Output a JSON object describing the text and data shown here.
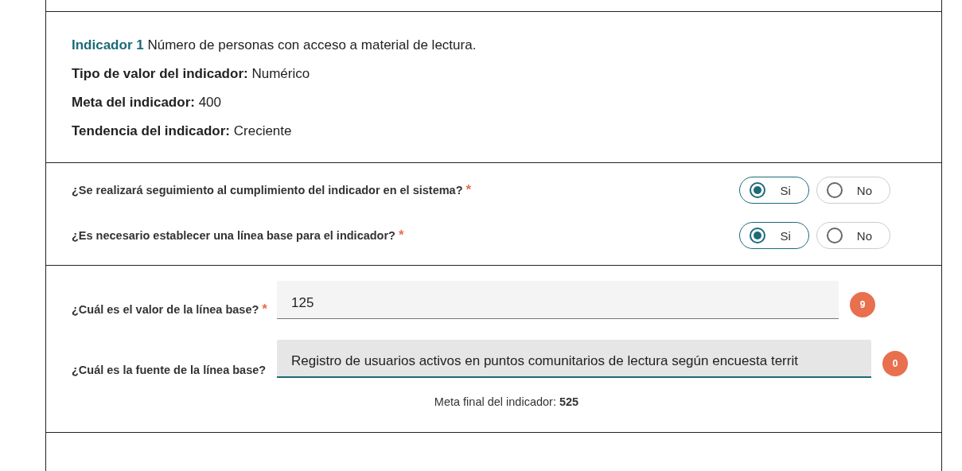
{
  "indicator": {
    "label": "Indicador 1",
    "description": "Número de personas con acceso a material de lectura."
  },
  "details": [
    {
      "label": "Tipo de valor del indicador:",
      "value": "Numérico"
    },
    {
      "label": "Meta del indicador:",
      "value": "400"
    },
    {
      "label": "Tendencia del indicador:",
      "value": "Creciente"
    }
  ],
  "questions": [
    {
      "text": "¿Se realizará seguimiento al cumplimiento del indicador en el sistema?",
      "required_mark": "*",
      "options": [
        {
          "label": "Si",
          "selected": true
        },
        {
          "label": "No",
          "selected": false
        }
      ]
    },
    {
      "text": "¿Es necesario establecer una línea base para el indicador?",
      "required_mark": "*",
      "options": [
        {
          "label": "Si",
          "selected": true
        },
        {
          "label": "No",
          "selected": false
        }
      ]
    }
  ],
  "fields": [
    {
      "label": "¿Cuál es el valor de la línea base?",
      "required_mark": "*",
      "value": "125",
      "counter": "9",
      "focused": false
    },
    {
      "label": "¿Cuál es la fuente de la línea base?",
      "value": "Registro de usuarios activos en puntos comunitarios de lectura según encuesta territ",
      "counter": "0",
      "focused": true
    }
  ],
  "summary": {
    "label": "Meta final del indicador:",
    "value": "525"
  }
}
